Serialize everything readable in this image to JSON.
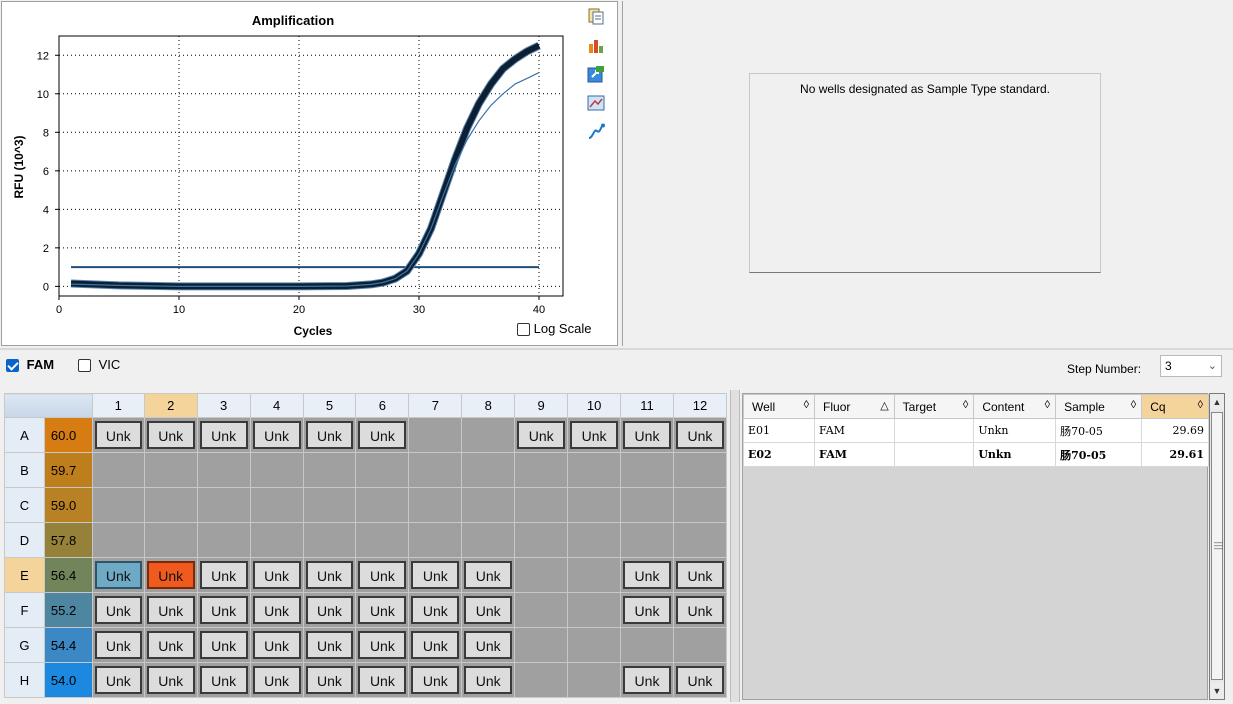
{
  "chart": {
    "title": "Amplification",
    "xlabel": "Cycles",
    "ylabel": "RFU (10^3)",
    "log_scale_label": "Log Scale",
    "log_scale_checked": false
  },
  "chart_data": {
    "type": "line",
    "title": "Amplification",
    "xlabel": "Cycles",
    "ylabel": "RFU (10^3)",
    "xlim": [
      0,
      42
    ],
    "ylim": [
      -0.5,
      13
    ],
    "xticks": [
      0,
      10,
      20,
      30,
      40
    ],
    "yticks": [
      0,
      2,
      4,
      6,
      8,
      10,
      12
    ],
    "grid": true,
    "threshold": 1.0,
    "series": [
      {
        "color": "#0d1f33",
        "x": [
          1,
          5,
          10,
          15,
          20,
          24,
          26,
          27,
          28,
          29,
          30,
          31,
          32,
          33,
          34,
          35,
          36,
          37,
          38,
          39,
          40
        ],
        "y": [
          0.15,
          0.05,
          0.0,
          0.0,
          0.0,
          0.02,
          0.1,
          0.2,
          0.4,
          0.8,
          1.7,
          3.0,
          4.8,
          6.6,
          8.2,
          9.5,
          10.5,
          11.3,
          11.8,
          12.2,
          12.5
        ]
      },
      {
        "color": "#3a75a8",
        "x": [
          1,
          5,
          10,
          15,
          20,
          24,
          26,
          27,
          28,
          29,
          30,
          31,
          32,
          33,
          34,
          35,
          36,
          37,
          38,
          39,
          40
        ],
        "y": [
          0.12,
          0.05,
          0.0,
          0.0,
          0.0,
          0.02,
          0.1,
          0.2,
          0.4,
          0.8,
          1.7,
          3.0,
          4.7,
          6.3,
          7.6,
          8.6,
          9.4,
          10.0,
          10.5,
          10.8,
          11.1
        ]
      }
    ]
  },
  "standard_curve": {
    "message": "No wells designated as Sample Type standard."
  },
  "fluors": [
    {
      "label": "FAM",
      "checked": true
    },
    {
      "label": "VIC",
      "checked": false
    }
  ],
  "step": {
    "label": "Step Number:",
    "value": "3"
  },
  "plate": {
    "columns": [
      "1",
      "2",
      "3",
      "4",
      "5",
      "6",
      "7",
      "8",
      "9",
      "10",
      "11",
      "12"
    ],
    "selected_column": "2",
    "selected_row": "E",
    "rows": [
      {
        "label": "A",
        "temp": "60.0",
        "temp_color": "#d77c12",
        "wells": [
          "Unk",
          "Unk",
          "Unk",
          "Unk",
          "Unk",
          "Unk",
          "",
          "",
          "Unk",
          "Unk",
          "Unk",
          "Unk"
        ]
      },
      {
        "label": "B",
        "temp": "59.7",
        "temp_color": "#bf7e1c",
        "wells": [
          "",
          "",
          "",
          "",
          "",
          "",
          "",
          "",
          "",
          "",
          "",
          ""
        ]
      },
      {
        "label": "C",
        "temp": "59.0",
        "temp_color": "#b78124",
        "wells": [
          "",
          "",
          "",
          "",
          "",
          "",
          "",
          "",
          "",
          "",
          "",
          ""
        ]
      },
      {
        "label": "D",
        "temp": "57.8",
        "temp_color": "#958139",
        "wells": [
          "",
          "",
          "",
          "",
          "",
          "",
          "",
          "",
          "",
          "",
          "",
          ""
        ]
      },
      {
        "label": "E",
        "temp": "56.4",
        "temp_color": "#71845a",
        "wells": [
          "Unk",
          "Unk",
          "Unk",
          "Unk",
          "Unk",
          "Unk",
          "Unk",
          "Unk",
          "",
          "",
          "Unk",
          "Unk"
        ]
      },
      {
        "label": "F",
        "temp": "55.2",
        "temp_color": "#4e86a1",
        "wells": [
          "Unk",
          "Unk",
          "Unk",
          "Unk",
          "Unk",
          "Unk",
          "Unk",
          "Unk",
          "",
          "",
          "Unk",
          "Unk"
        ]
      },
      {
        "label": "G",
        "temp": "54.4",
        "temp_color": "#3b88c4",
        "wells": [
          "Unk",
          "Unk",
          "Unk",
          "Unk",
          "Unk",
          "Unk",
          "Unk",
          "Unk",
          "",
          "",
          "",
          ""
        ]
      },
      {
        "label": "H",
        "temp": "54.0",
        "temp_color": "#1c88df",
        "wells": [
          "Unk",
          "Unk",
          "Unk",
          "Unk",
          "Unk",
          "Unk",
          "Unk",
          "Unk",
          "",
          "",
          "Unk",
          "Unk"
        ]
      }
    ]
  },
  "results": {
    "headers": [
      "Well",
      "Fluor",
      "Target",
      "Content",
      "Sample",
      "Cq"
    ],
    "header_sort_icons": [
      "◊",
      "△",
      "◊",
      "◊",
      "◊",
      "◊"
    ],
    "rows": [
      {
        "well": "E01",
        "fluor": "FAM",
        "target": "",
        "content": "Unkn",
        "sample": "肠70-05",
        "cq": "29.69"
      },
      {
        "well": "E02",
        "fluor": "FAM",
        "target": "",
        "content": "Unkn",
        "sample": "肠70-05",
        "cq": "29.61"
      }
    ]
  },
  "icons": [
    "copy-icon",
    "chart-settings-icon",
    "export-icon",
    "image-icon",
    "curve-icon"
  ]
}
